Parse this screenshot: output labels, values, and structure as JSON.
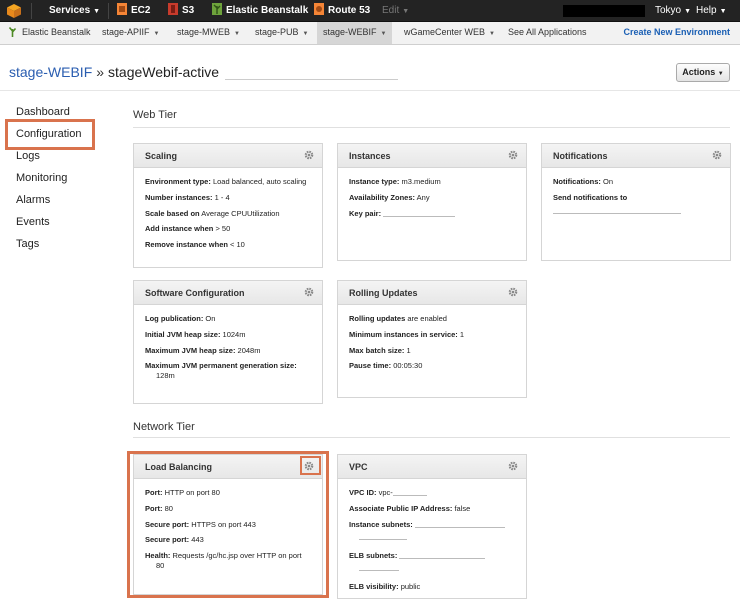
{
  "topnav": {
    "services": "Services",
    "ec2": "EC2",
    "s3": "S3",
    "elastic_beanstalk": "Elastic Beanstalk",
    "route53": "Route 53",
    "edit": "Edit",
    "region": "Tokyo",
    "help": "Help"
  },
  "subnav": {
    "tabs": [
      "Elastic Beanstalk",
      "stage-APIIF",
      "stage-MWEB",
      "stage-PUB",
      "stage-WEBIF",
      "wGameCenter WEB",
      "See All Applications"
    ],
    "create_env": "Create New Environment"
  },
  "title": {
    "app": "stage-WEBIF",
    "separator": "»",
    "env": "stageWebif-active"
  },
  "actions_label": "Actions",
  "sidebar": {
    "items": [
      "Dashboard",
      "Configuration",
      "Logs",
      "Monitoring",
      "Alarms",
      "Events",
      "Tags"
    ]
  },
  "sections": {
    "web_tier": "Web Tier",
    "network_tier": "Network Tier"
  },
  "panels": {
    "scaling": {
      "title": "Scaling",
      "rows": [
        {
          "label": "Environment type:",
          "value": "Load balanced, auto scaling"
        },
        {
          "label": "Number instances:",
          "value": "1 - 4"
        },
        {
          "label": "Scale based on",
          "value": "Average CPUUtilization"
        },
        {
          "label": "Add instance when",
          "value": "> 50"
        },
        {
          "label": "Remove instance when",
          "value": "< 10"
        }
      ]
    },
    "instances": {
      "title": "Instances",
      "rows": [
        {
          "label": "Instance type:",
          "value": "m3.medium"
        },
        {
          "label": "Availability Zones:",
          "value": "Any"
        },
        {
          "label": "Key pair:",
          "value": ""
        }
      ]
    },
    "notifications": {
      "title": "Notifications",
      "rows": [
        {
          "label": "Notifications:",
          "value": "On"
        },
        {
          "label": "Send notifications to",
          "value": ""
        }
      ]
    },
    "software": {
      "title": "Software Configuration",
      "rows": [
        {
          "label": "Log publication:",
          "value": "On"
        },
        {
          "label": "Initial JVM heap size:",
          "value": "1024m"
        },
        {
          "label": "Maximum JVM heap size:",
          "value": "2048m"
        },
        {
          "label": "Maximum JVM permanent generation size:",
          "value": "128m"
        }
      ]
    },
    "rolling": {
      "title": "Rolling Updates",
      "rows": [
        {
          "label": "Rolling updates",
          "value": "are enabled"
        },
        {
          "label": "Minimum instances in service:",
          "value": "1"
        },
        {
          "label": "Max batch size:",
          "value": "1"
        },
        {
          "label": "Pause time:",
          "value": "00:05:30"
        }
      ]
    },
    "lb": {
      "title": "Load Balancing",
      "rows": [
        {
          "label": "Port:",
          "value": "HTTP on port 80"
        },
        {
          "label": "Port:",
          "value": "80"
        },
        {
          "label": "Secure port:",
          "value": "HTTPS on port 443"
        },
        {
          "label": "Secure port:",
          "value": "443"
        },
        {
          "label": "Health:",
          "value": "Requests /gc/hc.jsp over HTTP on port",
          "cont": "80"
        }
      ]
    },
    "vpc": {
      "title": "VPC",
      "rows": [
        {
          "label": "VPC ID:",
          "value": "vpc-"
        },
        {
          "label": "Associate Public IP Address:",
          "value": "false"
        },
        {
          "label": "Instance subnets:",
          "value": ""
        },
        {
          "label": "ELB subnets:",
          "value": ""
        },
        {
          "label": "ELB visibility:",
          "value": "public"
        }
      ]
    }
  },
  "colors": {
    "highlight": "#d9734d",
    "link": "#2a5db0",
    "topbar": "#232323"
  }
}
